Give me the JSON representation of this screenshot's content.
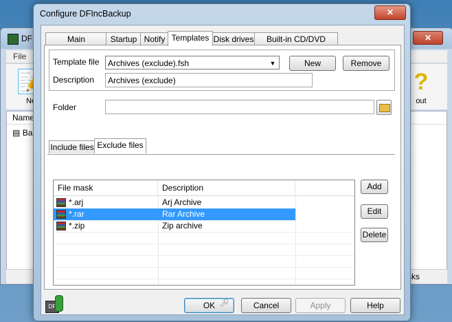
{
  "background_window": {
    "title": "DF",
    "close_label": "✕",
    "menu": [
      "File"
    ],
    "toolbar": [
      {
        "label": "Ne",
        "icon": "new-icon"
      },
      {
        "label": "out",
        "icon": "about-icon"
      }
    ],
    "list_header": "Name",
    "list_item": "Ba",
    "status_text": "asks"
  },
  "dialog": {
    "title": "Configure DFIncBackup",
    "close_label": "✕",
    "tabs": [
      {
        "label": "Main Parameters"
      },
      {
        "label": "Startup"
      },
      {
        "label": "Notify"
      },
      {
        "label": "Templates",
        "active": true
      },
      {
        "label": "Disk drives"
      },
      {
        "label": "Built-in CD/DVD burner"
      }
    ],
    "template_file_label": "Template file",
    "template_file_value": "Archives (exclude).fsh",
    "new_button": "New",
    "remove_button": "Remove",
    "description_label": "Description",
    "description_value": "Archives (exclude)",
    "folder_label": "Folder",
    "folder_value": "",
    "subtabs": [
      {
        "label": "Include files"
      },
      {
        "label": "Exclude files",
        "active": true
      }
    ],
    "list": {
      "columns": [
        "File mask",
        "Description"
      ],
      "rows": [
        {
          "mask": "*.arj",
          "description": "Arj Archive",
          "selected": false
        },
        {
          "mask": "*.rar",
          "description": "Rar Archive",
          "selected": true
        },
        {
          "mask": "*.zip",
          "description": "Zip archive",
          "selected": false
        }
      ]
    },
    "add_button": "Add",
    "edit_button": "Edit",
    "delete_button": "Delete",
    "ok_button": "OK",
    "cancel_button": "Cancel",
    "apply_button": "Apply",
    "help_button": "Help"
  },
  "colors": {
    "selection": "#3399ff",
    "close_button": "#c4432a",
    "dialog_frame": "#a8c1db"
  }
}
